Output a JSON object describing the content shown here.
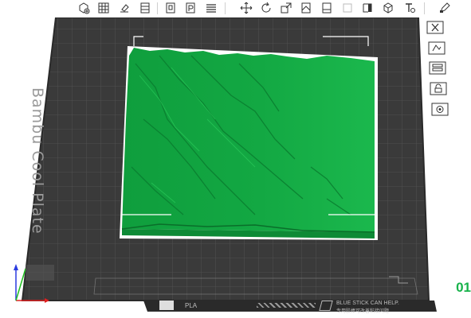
{
  "toolbar": {
    "icons": [
      "add-cube-icon",
      "grid-icon",
      "import-icon",
      "table-icon",
      "plate-icon",
      "plate-p-icon",
      "list-icon",
      "move-icon",
      "rotate-icon",
      "scale-icon",
      "align-icon",
      "color-icon",
      "split-icon",
      "cut-icon",
      "box-icon",
      "text-icon",
      "paint-icon"
    ]
  },
  "side_panel": {
    "icons": [
      "close-icon",
      "arrange-icon",
      "layers-icon",
      "lock-icon",
      "settings-icon"
    ]
  },
  "plate": {
    "label": "Bambu Cool Plate",
    "number": "01",
    "filament": "PLA",
    "notice_line1": "BLUE STICK CAN HELP.",
    "notice_line2": "专用胶棒可改善粘接问题"
  },
  "colors": {
    "plate": "#3a3a3a",
    "grid": "#5a5a5a",
    "model": "#17b24a",
    "accent": "#17b24a"
  }
}
